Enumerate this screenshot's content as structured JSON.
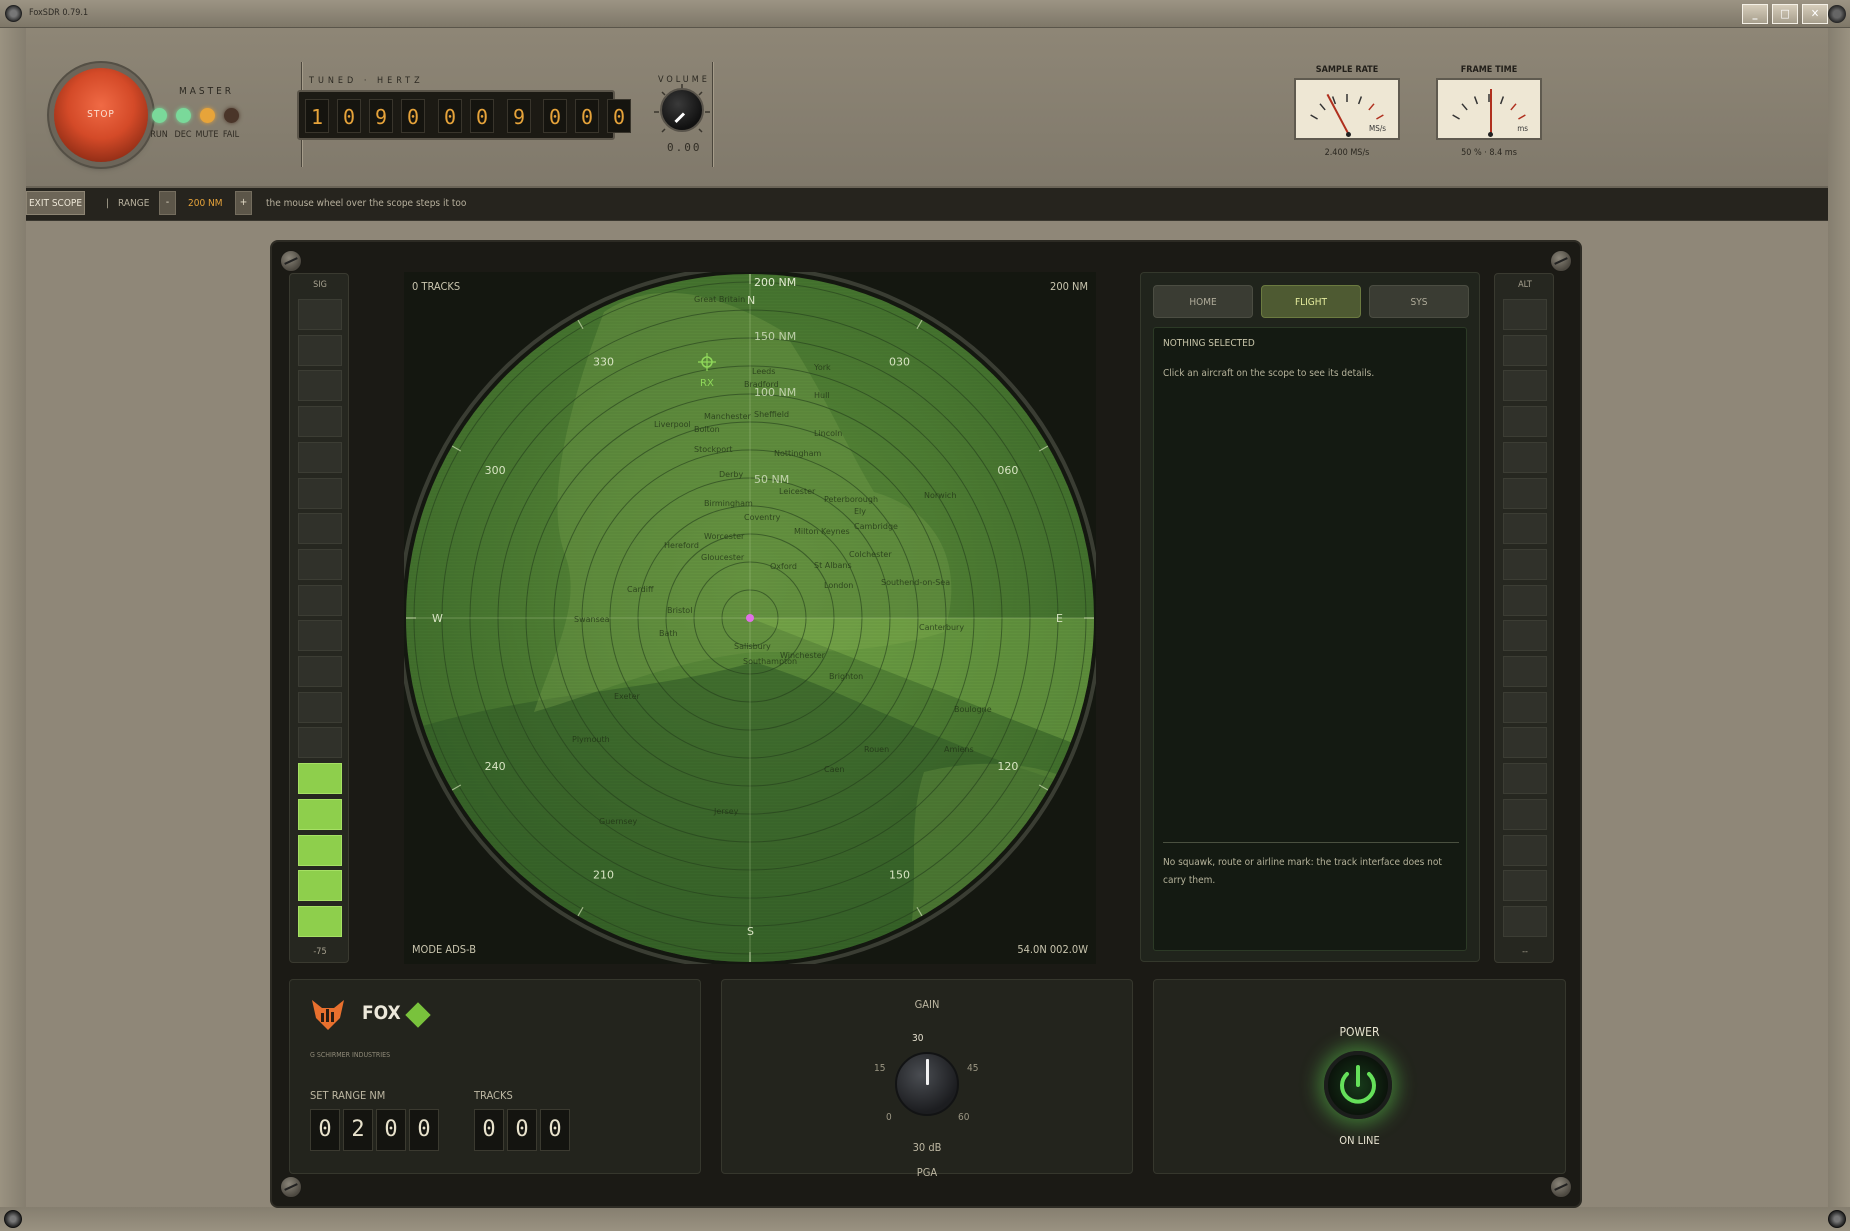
{
  "window": {
    "title": "FoxSDR 0.79.1",
    "buttons": {
      "minimize": "_",
      "maximize": "□",
      "close": "✕"
    }
  },
  "top": {
    "stop_label": "STOP",
    "master_label": "MASTER",
    "leds": [
      {
        "label": "RUN",
        "color": "#7ad99a"
      },
      {
        "label": "DEC",
        "color": "#7ad99a"
      },
      {
        "label": "MUTE",
        "color": "#e7a43a"
      },
      {
        "label": "FAIL",
        "color": "#4a3529"
      }
    ],
    "tuned_label": "TUNED · HERTZ",
    "freq_digits": [
      "1",
      "0",
      "9",
      "0",
      "0",
      "0",
      "9",
      "0",
      "0",
      "0"
    ],
    "volume_label": "VOLUME",
    "volume_value": "0.00",
    "meters": [
      {
        "label": "SAMPLE RATE",
        "unit": "MS/s",
        "caption": "2.400 MS/s",
        "needle_deg": -28
      },
      {
        "label": "FRAME TIME",
        "unit": "ms",
        "caption": "50 % · 8.4 ms",
        "needle_deg": 0
      }
    ]
  },
  "toolbar": {
    "exit_scope": "EXIT SCOPE",
    "sep": "|",
    "range_label": "RANGE",
    "minus": "-",
    "range_value": "200 NM",
    "plus": "+",
    "hint": "the mouse wheel over the scope steps it too"
  },
  "sig": {
    "label": "SIG",
    "value": "-75",
    "lit_segments": 5
  },
  "alt": {
    "label": "ALT",
    "value": "--"
  },
  "scope": {
    "tracks": "0 TRACKS",
    "range_top_right": "200 NM",
    "mode": "MODE ADS-B",
    "position": "54.0N 002.0W",
    "ring_labels": [
      "200 NM",
      "150 NM",
      "100 NM",
      "50 NM"
    ],
    "cardinals": {
      "n": "N",
      "s": "S",
      "e": "E",
      "w": "W"
    },
    "bearings": [
      "030",
      "060",
      "120",
      "150",
      "210",
      "240",
      "300",
      "330"
    ],
    "rx_label": "RX",
    "places": [
      "Great Britain",
      "Leeds",
      "York",
      "Hull",
      "Bradford",
      "Manchester",
      "Sheffield",
      "Lincoln",
      "Bolton",
      "Liverpool",
      "Stockport",
      "Derby",
      "Nottingham",
      "Norwich",
      "Birmingham",
      "Leicester",
      "Peterborough",
      "Ely",
      "Coventry",
      "Cambridge",
      "Milton Keynes",
      "Worcester",
      "Hereford",
      "Gloucester",
      "Oxford",
      "Colchester",
      "St Albans",
      "London",
      "Southend-on-Sea",
      "Cardiff",
      "Bristol",
      "Bath",
      "Salisbury",
      "Winchester",
      "Southampton",
      "Brighton",
      "Canterbury",
      "Plymouth",
      "Exeter",
      "Boulogne",
      "Amiens",
      "Rouen",
      "Caen",
      "Guernsey",
      "Jersey",
      "Swansea"
    ]
  },
  "info": {
    "tabs": [
      "HOME",
      "FLIGHT",
      "SYS"
    ],
    "active_tab": "FLIGHT",
    "heading": "NOTHING SELECTED",
    "text": "Click an aircraft on the scope to see its details.",
    "note": "No squawk, route or airline mark: the track interface does not carry them."
  },
  "brand": {
    "name": "FOX",
    "maker": "G SCHIRMER INDUSTRIES",
    "range_label": "SET RANGE NM",
    "range_digits": [
      "0",
      "2",
      "0",
      "0"
    ],
    "tracks_label": "TRACKS",
    "tracks_digits": [
      "0",
      "0",
      "0"
    ]
  },
  "gain": {
    "label": "GAIN",
    "scale": [
      "30",
      "15",
      "45",
      "0",
      "60"
    ],
    "value": "30 dB",
    "mode": "PGA"
  },
  "power": {
    "label": "POWER",
    "status": "ON LINE"
  },
  "colors": {
    "accent_amber": "#e6a33a",
    "scope_green": "#6fb04a",
    "power_green": "#5fd250",
    "stop_red": "#d44a28"
  }
}
